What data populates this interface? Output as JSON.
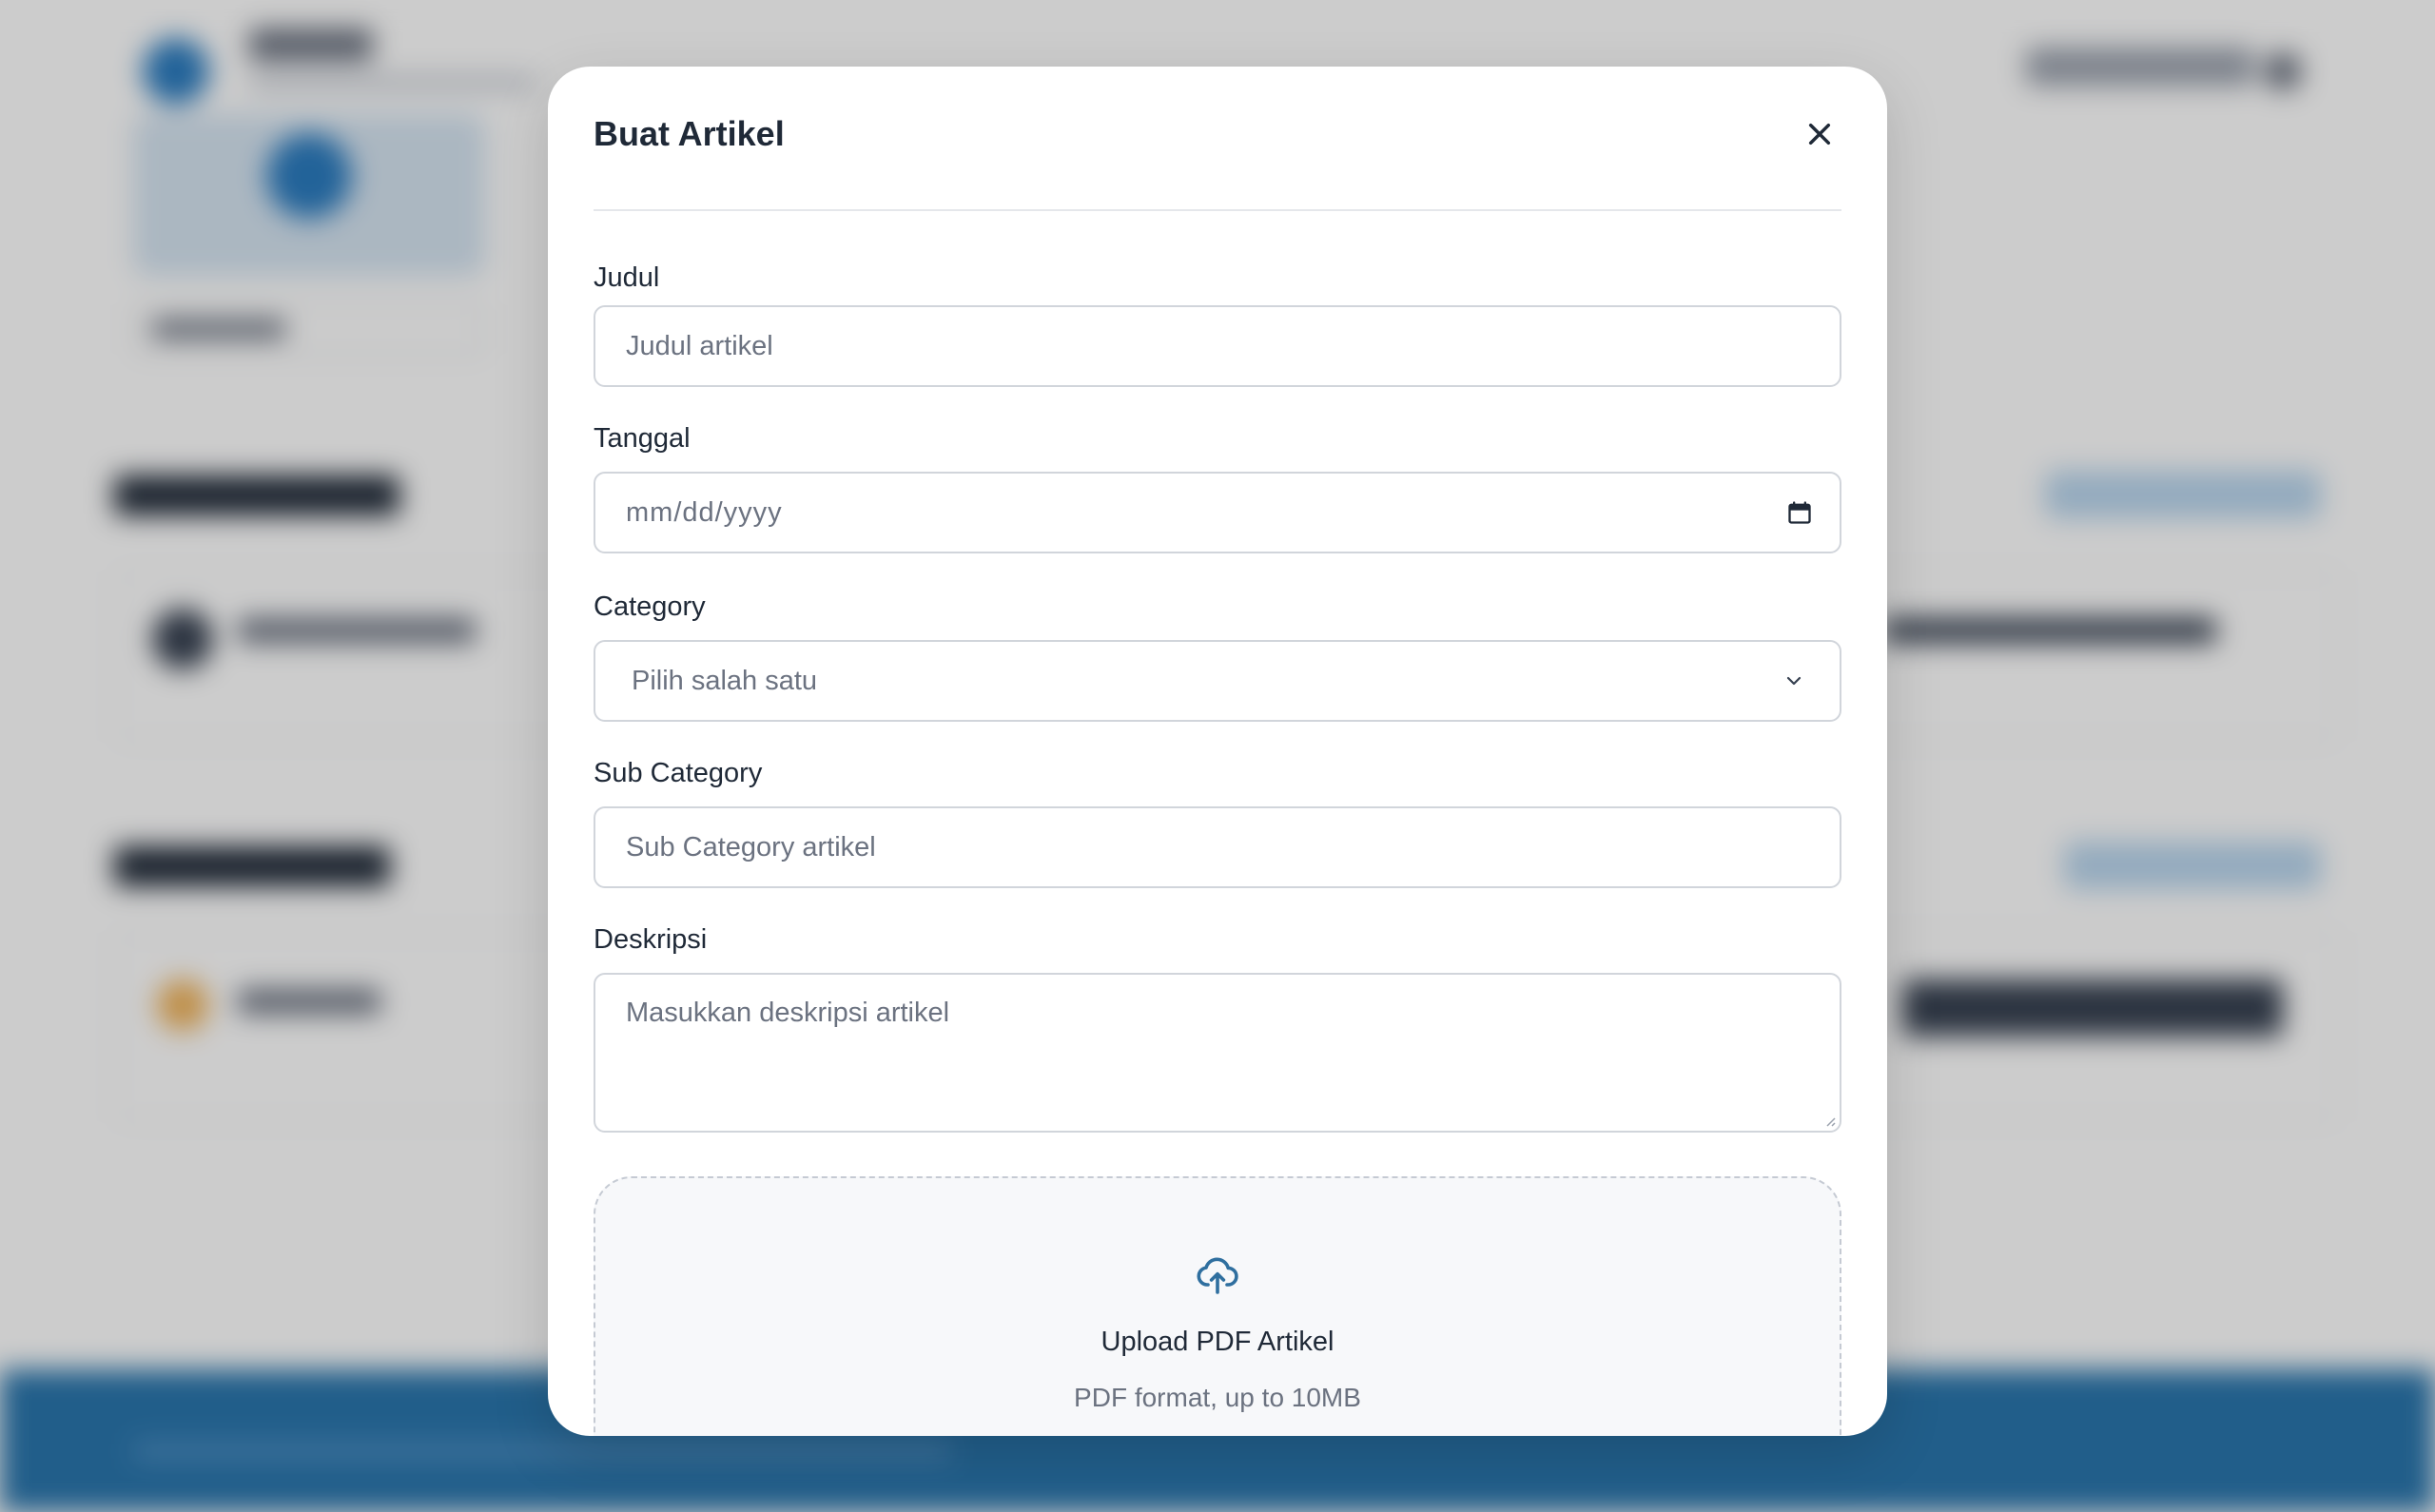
{
  "modal": {
    "title": "Buat Artikel",
    "close_icon": "close-icon"
  },
  "form": {
    "judul": {
      "label": "Judul",
      "placeholder": "Judul artikel"
    },
    "tanggal": {
      "label": "Tanggal",
      "placeholder": "mm/dd/yyyy",
      "icon": "calendar-icon"
    },
    "category": {
      "label": "Category",
      "selected": "Pilih salah satu",
      "icon": "chevron-down-icon"
    },
    "sub_category": {
      "label": "Sub Category",
      "placeholder": "Sub Category artikel"
    },
    "deskripsi": {
      "label": "Deskripsi",
      "placeholder": "Masukkan deskripsi artikel"
    }
  },
  "upload": {
    "icon": "cloud-upload-icon",
    "title": "Upload PDF Artikel",
    "subtitle": "PDF format, up to 10MB"
  },
  "colors": {
    "overlay": "#000000",
    "footer": "#2a76ad",
    "upload_icon": "#2f6f9f"
  }
}
